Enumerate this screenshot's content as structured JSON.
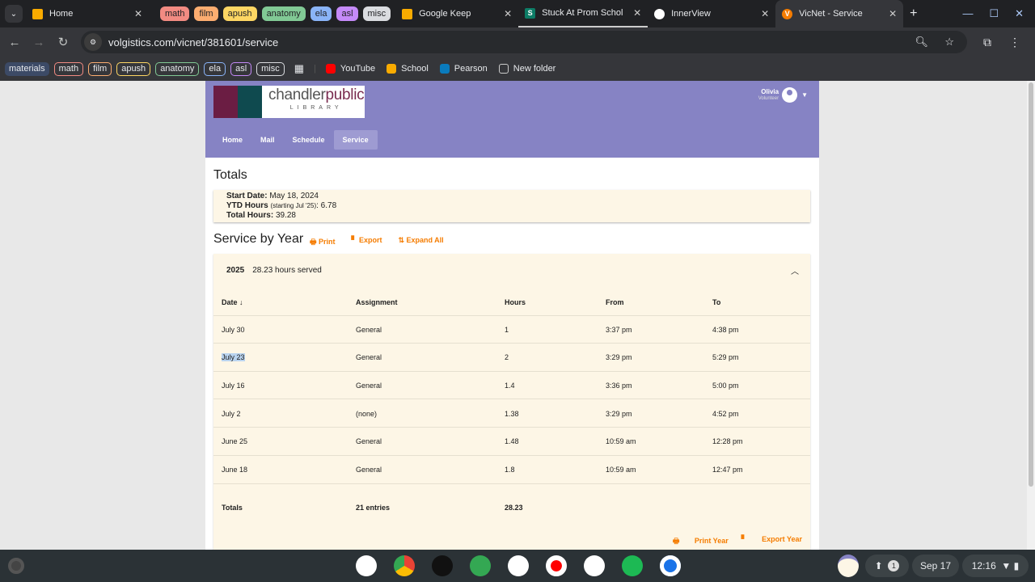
{
  "browser": {
    "tabs": [
      {
        "title": "Home",
        "icon": "classroom-icon",
        "color": "#f9ab00"
      },
      {
        "title": "Google Keep",
        "icon": "keep-icon",
        "color": "#f9ab00"
      },
      {
        "title": "Stuck At Prom Scholar",
        "icon": "s-icon",
        "color": "#0d7c66"
      },
      {
        "title": "InnerView",
        "icon": "innerview-icon",
        "color": "#fff"
      },
      {
        "title": "VicNet - Service",
        "icon": "vicnet-icon",
        "color": "#f57c00",
        "active": true
      }
    ],
    "tab_groups": [
      {
        "label": "math",
        "color": "#f28b82"
      },
      {
        "label": "film",
        "color": "#fcad70"
      },
      {
        "label": "apush",
        "color": "#fdd663"
      },
      {
        "label": "anatomy",
        "color": "#81c995"
      },
      {
        "label": "ela",
        "color": "#8ab4f8"
      },
      {
        "label": "asl",
        "color": "#c58af9"
      },
      {
        "label": "misc",
        "color": "#dadce0"
      }
    ],
    "url": "volgistics.com/vicnet/381601/service",
    "bookmark_groups": [
      {
        "label": "materials",
        "color": "#8ab4f8"
      },
      {
        "label": "math",
        "color": "#f28b82"
      },
      {
        "label": "film",
        "color": "#fcad70"
      },
      {
        "label": "apush",
        "color": "#fdd663"
      },
      {
        "label": "anatomy",
        "color": "#81c995"
      },
      {
        "label": "ela",
        "color": "#8ab4f8"
      },
      {
        "label": "asl",
        "color": "#c58af9"
      },
      {
        "label": "misc",
        "color": "#dadce0"
      }
    ],
    "bookmarks": [
      {
        "label": "YouTube",
        "color": "#f00"
      },
      {
        "label": "School",
        "color": "#f9ab00"
      },
      {
        "label": "Pearson",
        "color": "#0a7bbd"
      },
      {
        "label": "New folder",
        "color": "transparent"
      }
    ]
  },
  "site": {
    "logo": {
      "word1": "chandler",
      "word2": "public",
      "word3": "LIBRARY"
    },
    "user": {
      "name": "Olivia",
      "role": "Volunteer"
    },
    "nav": [
      "Home",
      "Mail",
      "Schedule",
      "Service"
    ],
    "active_nav": "Service",
    "accent": "#8683c4"
  },
  "totals": {
    "title": "Totals",
    "start_label": "Start Date:",
    "start": "May 18, 2024",
    "ytd_label": "YTD Hours",
    "ytd_note": "(starting Jul '25)",
    "ytd": ": 6.78",
    "total_label": "Total Hours:",
    "total": "39.28"
  },
  "service": {
    "title": "Service by Year",
    "actions": [
      "Print",
      "Export",
      "Expand All"
    ],
    "year": "2025",
    "year_summary": "28.23 hours served",
    "columns": [
      "Date ↓",
      "Assignment",
      "Hours",
      "From",
      "To"
    ],
    "rows": [
      [
        "July 30",
        "General",
        "1",
        "3:37 pm",
        "4:38 pm"
      ],
      [
        "July 23",
        "General",
        "2",
        "3:29 pm",
        "5:29 pm"
      ],
      [
        "July 16",
        "General",
        "1.4",
        "3:36 pm",
        "5:00 pm"
      ],
      [
        "July 2",
        "(none)",
        "1.38",
        "3:29 pm",
        "4:52 pm"
      ],
      [
        "June 25",
        "General",
        "1.48",
        "10:59 am",
        "12:28 pm"
      ],
      [
        "June 18",
        "General",
        "1.8",
        "10:59 am",
        "12:47 pm"
      ]
    ],
    "footer": [
      "Totals",
      "21 entries",
      "28.23"
    ],
    "year_actions": [
      "Print Year",
      "Export Year"
    ]
  },
  "shelf": {
    "date": "Sep 17",
    "time": "12:16",
    "notifications": "1"
  }
}
